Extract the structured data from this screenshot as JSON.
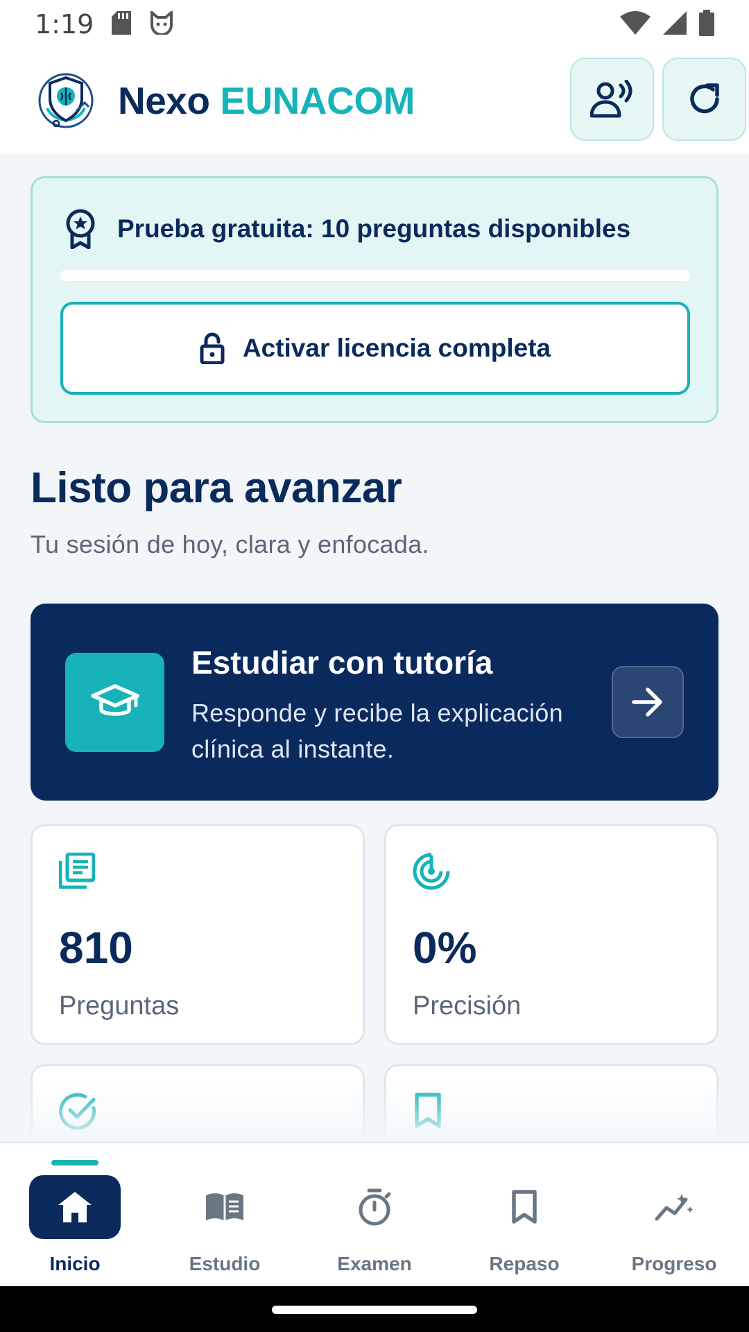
{
  "status_bar": {
    "time": "1:19"
  },
  "header": {
    "title_prefix": "Nexo",
    "title_accent": "EUNACOM"
  },
  "trial": {
    "message": "Prueba gratuita: 10 preguntas disponibles",
    "progress_fraction": 0,
    "license_button": "Activar licencia completa"
  },
  "main": {
    "title": "Listo para avanzar",
    "subtitle": "Tu sesión de hoy, clara y enfocada.",
    "tutor": {
      "title": "Estudiar con tutoría",
      "description": "Responde y recibe la explicación clínica al instante."
    },
    "stats": [
      {
        "value": "810",
        "label": "Preguntas",
        "icon": "question-list-icon"
      },
      {
        "value": "0%",
        "label": "Precisión",
        "icon": "target-icon"
      }
    ]
  },
  "bottom_nav": {
    "items": [
      {
        "label": "Inicio",
        "icon": "home-icon",
        "active": true
      },
      {
        "label": "Estudio",
        "icon": "book-icon",
        "active": false
      },
      {
        "label": "Examen",
        "icon": "stopwatch-icon",
        "active": false
      },
      {
        "label": "Repaso",
        "icon": "bookmark-icon",
        "active": false
      },
      {
        "label": "Progreso",
        "icon": "trend-icon",
        "active": false
      }
    ]
  },
  "colors": {
    "navy": "#0a2a5e",
    "teal": "#16b3b8",
    "background": "#f2f6f9"
  }
}
